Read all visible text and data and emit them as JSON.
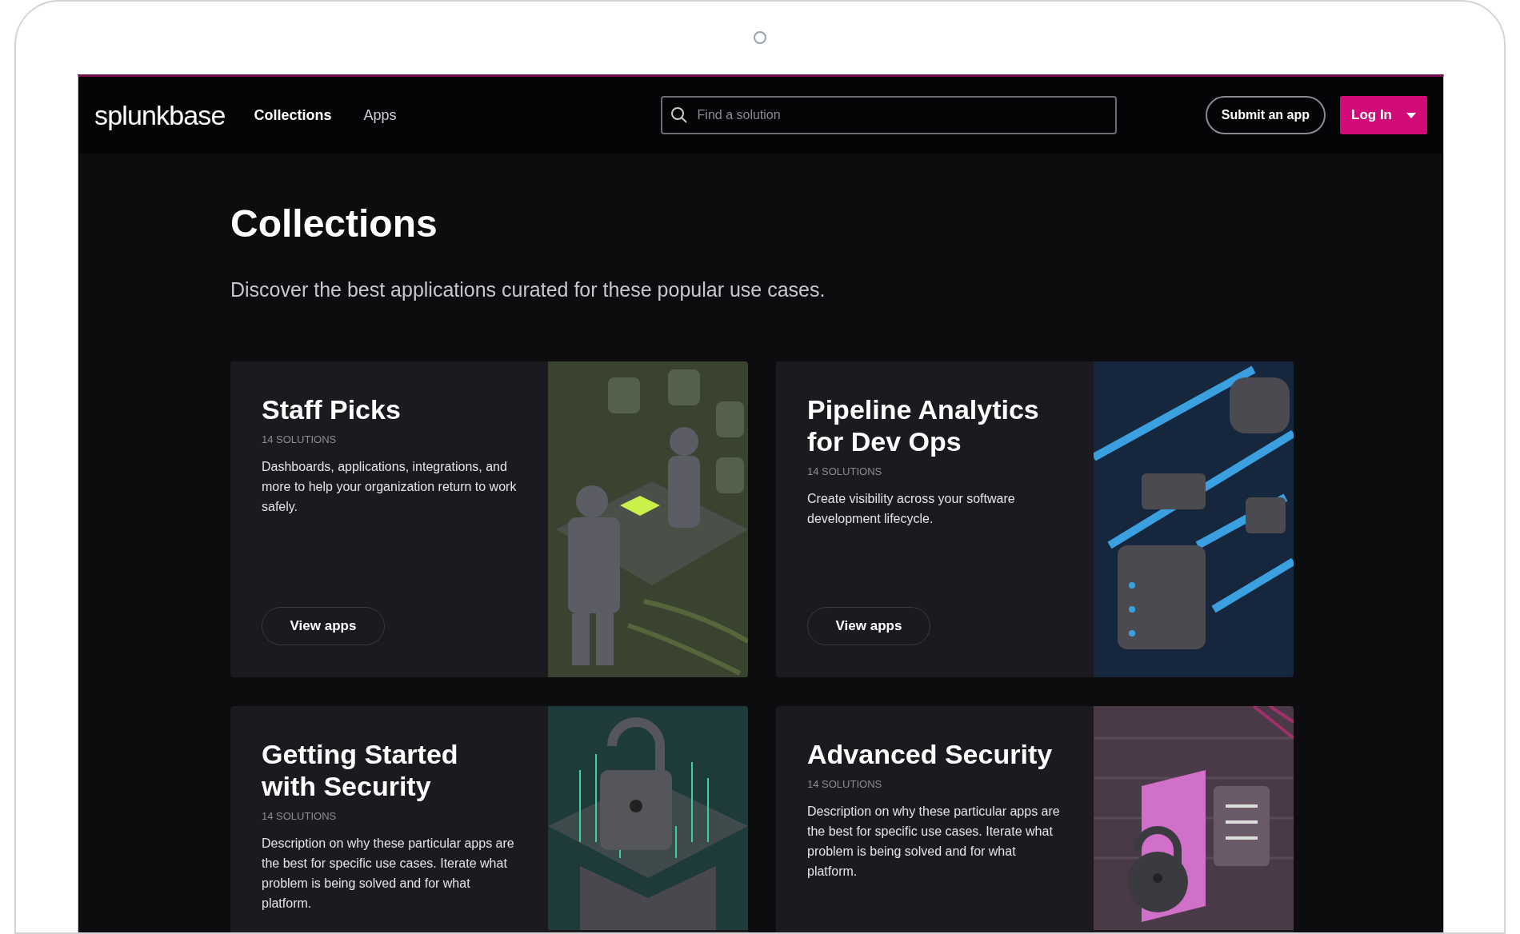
{
  "header": {
    "logo": "splunkbase",
    "nav": [
      {
        "label": "Collections",
        "selected": true
      },
      {
        "label": "Apps",
        "selected": false
      }
    ],
    "search": {
      "placeholder": "Find a solution"
    },
    "submit_button": "Submit an app",
    "login_button": "Log In"
  },
  "page": {
    "title": "Collections",
    "subtitle": "Discover the best applications curated for these popular use cases."
  },
  "cards": [
    {
      "title": "Staff Picks",
      "count": "14 SOLUTIONS",
      "description": "Dashboards, applications, integrations, and more to help your organization return to work safely.",
      "button": "View apps",
      "kind": "people"
    },
    {
      "title": "Pipeline Analytics for Dev Ops",
      "count": "14 SOLUTIONS",
      "description": "Create visibility across your software development lifecycle.",
      "button": "View apps",
      "kind": "pipes"
    },
    {
      "title": "Getting Started with Security",
      "count": "14 SOLUTIONS",
      "description": "Description on why  these particular apps are the best for specific use cases. Iterate what problem is being solved and for what platform.",
      "kind": "lock-green"
    },
    {
      "title": "Advanced Security",
      "count": "14 SOLUTIONS",
      "description": "Description on why  these particular apps are the best for specific use cases. Iterate what problem is being solved and for what platform.",
      "kind": "lock-pink"
    }
  ]
}
